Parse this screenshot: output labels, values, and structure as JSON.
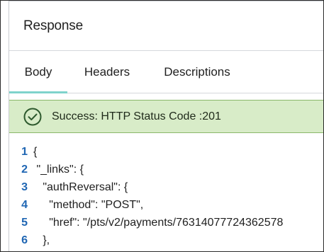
{
  "response": {
    "title": "Response",
    "tabs": [
      {
        "label": "Body",
        "active": true
      },
      {
        "label": "Headers",
        "active": false
      },
      {
        "label": "Descriptions",
        "active": false
      }
    ],
    "status": {
      "icon": "check-circle-icon",
      "message": "Success: HTTP Status Code :201",
      "color": "#2e5a2e",
      "background": "#d8ecc8"
    },
    "code_lines": [
      {
        "num": "1",
        "text": "{"
      },
      {
        "num": "2",
        "text": " \"_links\": {"
      },
      {
        "num": "3",
        "text": "   \"authReversal\": {"
      },
      {
        "num": "4",
        "text": "     \"method\": \"POST\","
      },
      {
        "num": "5",
        "text": "     \"href\": \"/pts/v2/payments/76314077724362578"
      },
      {
        "num": "6",
        "text": "   },"
      }
    ]
  },
  "colors": {
    "accent_tab_underline": "#7fd3cc",
    "line_number": "#1f66b3"
  }
}
